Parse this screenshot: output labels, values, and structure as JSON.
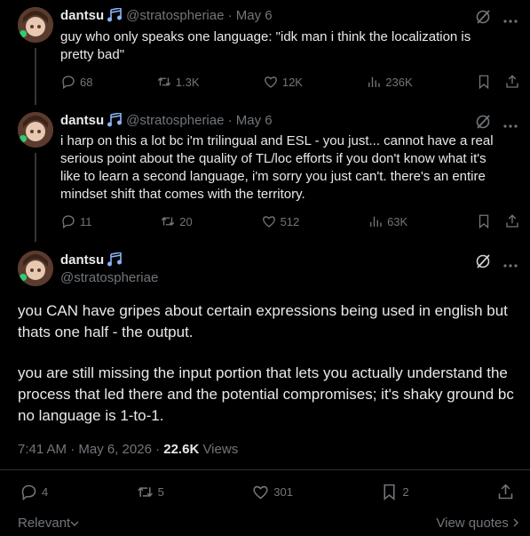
{
  "tweets": [
    {
      "name": "dantsu",
      "handle": "@stratospheriae",
      "date": "May 6",
      "text": "guy who only speaks one language: \"idk man i think the localization is pretty bad\"",
      "replies": "68",
      "reposts": "1.3K",
      "likes": "12K",
      "views": "236K"
    },
    {
      "name": "dantsu",
      "handle": "@stratospheriae",
      "date": "May 6",
      "text": "i harp on this a lot bc i'm trilingual and ESL - you just... cannot have a real serious point about the quality of TL/loc efforts if you don't know what it's like to learn a second language, i'm sorry you just can't. there's an entire mindset shift that comes with the territory.",
      "replies": "11",
      "reposts": "20",
      "likes": "512",
      "views": "63K"
    }
  ],
  "main": {
    "name": "dantsu",
    "handle": "@stratospheriae",
    "para1": "you CAN have gripes about certain expressions being used in english but thats one half - the output.",
    "para2": "you are still missing the input portion that lets you actually understand the process that led there and the potential compromises; it's shaky ground bc no language is 1-to-1.",
    "time": "7:41 AM · May 6, 2026 ·",
    "views_count": "22.6K",
    "views_label": "Views",
    "replies": "4",
    "reposts": "5",
    "likes": "301",
    "bookmarks": "2"
  },
  "footer": {
    "relevant": "Relevant",
    "view_quotes": "View quotes"
  },
  "colors": {
    "background": "#000000",
    "text": "#e7e9ea",
    "muted": "#71767b",
    "badge": "#8ab4f8"
  }
}
